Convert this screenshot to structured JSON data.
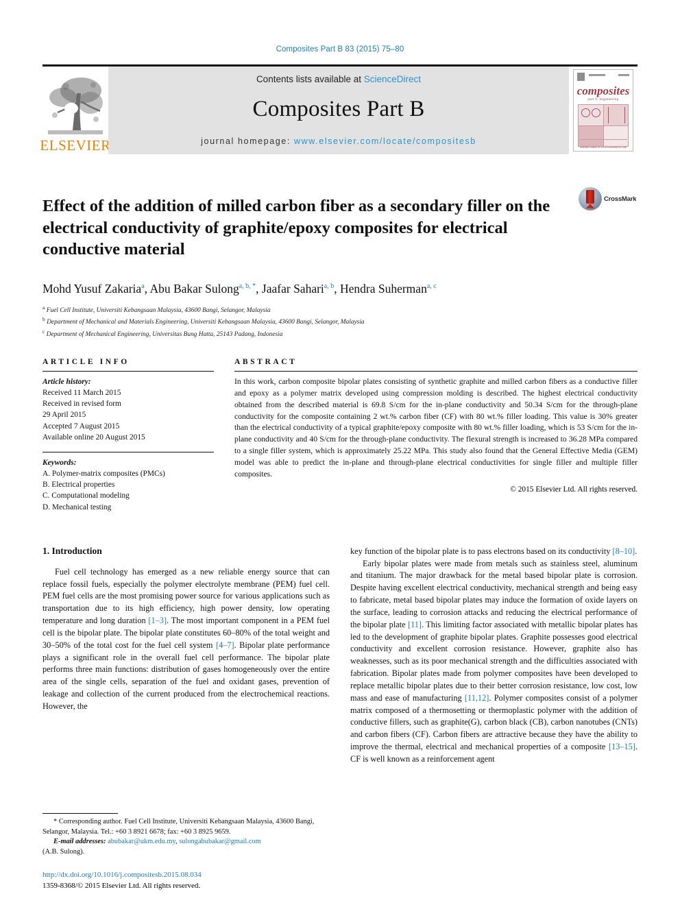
{
  "running_head": "Composites Part B 83 (2015) 75–80",
  "masthead": {
    "publisher": "ELSEVIER",
    "contents_prefix": "Contents lists available at ",
    "contents_link": "ScienceDirect",
    "journal_title": "Composites Part B",
    "homepage_prefix": "journal homepage: ",
    "homepage_url": "www.elsevier.com/locate/compositesb",
    "cover": {
      "title": "composites",
      "subtitle": "part b: engineering",
      "footer": "available online at www.sciencedirect.com"
    }
  },
  "article": {
    "title": "Effect of the addition of milled carbon fiber as a secondary filler on the electrical conductivity of graphite/epoxy composites for electrical conductive material",
    "crossmark_label": "CrossMark",
    "authors": [
      {
        "name": "Mohd Yusuf Zakaria",
        "marks": "a"
      },
      {
        "name": "Abu Bakar Sulong",
        "marks": "a, b, *"
      },
      {
        "name": "Jaafar Sahari",
        "marks": "a, b"
      },
      {
        "name": "Hendra Suherman",
        "marks": "a, c"
      }
    ],
    "affiliations": [
      {
        "mark": "a",
        "text": "Fuel Cell Institute, Universiti Kebangsaan Malaysia, 43600 Bangi, Selangor, Malaysia"
      },
      {
        "mark": "b",
        "text": "Department of Mechanical and Materials Engineering, Universiti Kebangsaan Malaysia, 43600 Bangi, Selangor, Malaysia"
      },
      {
        "mark": "c",
        "text": "Department of Mechanical Engineering, Universitas Bung Hatta, 25143 Padang, Indonesia"
      }
    ]
  },
  "article_info": {
    "heading": "ARTICLE INFO",
    "history_label": "Article history:",
    "history": [
      "Received 11 March 2015",
      "Received in revised form",
      "29 April 2015",
      "Accepted 7 August 2015",
      "Available online 20 August 2015"
    ],
    "keywords_label": "Keywords:",
    "keywords": [
      "A. Polymer-matrix composites (PMCs)",
      "B. Electrical properties",
      "C. Computational modeling",
      "D. Mechanical testing"
    ]
  },
  "abstract": {
    "heading": "ABSTRACT",
    "text": "In this work, carbon composite bipolar plates consisting of synthetic graphite and milled carbon fibers as a conductive filler and epoxy as a polymer matrix developed using compression molding is described. The highest electrical conductivity obtained from the described material is 69.8 S/cm for the in-plane conductivity and 50.34 S/cm for the through-plane conductivity for the composite containing 2 wt.% carbon fiber (CF) with 80 wt.% filler loading. This value is 30% greater than the electrical conductivity of a typical graphite/epoxy composite with 80 wt.% filler loading, which is 53 S/cm for the in-plane conductivity and 40 S/cm for the through-plane conductivity. The flexural strength is increased to 36.28 MPa compared to a single filler system, which is approximately 25.22 MPa. This study also found that the General Effective Media (GEM) model was able to predict the in-plane and through-plane electrical conductivities for single filler and multiple filler composites.",
    "copyright": "© 2015 Elsevier Ltd. All rights reserved."
  },
  "introduction": {
    "section_number": "1.",
    "section_title": "Introduction",
    "left_paragraphs": [
      "Fuel cell technology has emerged as a new reliable energy source that can replace fossil fuels, especially the polymer electrolyte membrane (PEM) fuel cell. PEM fuel cells are the most promising power source for various applications such as transportation due to its high efficiency, high power density, low operating temperature and long duration [1–3]. The most important component in a PEM fuel cell is the bipolar plate. The bipolar plate constitutes 60–80% of the total weight and 30–50% of the total cost for the fuel cell system [4–7]. Bipolar plate performance plays a significant role in the overall fuel cell performance. The bipolar plate performs three main functions: distribution of gases homogeneously over the entire area of the single cells, separation of the fuel and oxidant gases, prevention of leakage and collection of the current produced from the electrochemical reactions. However, the"
    ],
    "right_paragraphs": [
      "key function of the bipolar plate is to pass electrons based on its conductivity [8–10].",
      "Early bipolar plates were made from metals such as stainless steel, aluminum and titanium. The major drawback for the metal based bipolar plate is corrosion. Despite having excellent electrical conductivity, mechanical strength and being easy to fabricate, metal based bipolar plates may induce the formation of oxide layers on the surface, leading to corrosion attacks and reducing the electrical performance of the bipolar plate [11]. This limiting factor associated with metallic bipolar plates has led to the development of graphite bipolar plates. Graphite possesses good electrical conductivity and excellent corrosion resistance. However, graphite also has weaknesses, such as its poor mechanical strength and the difficulties associated with fabrication. Bipolar plates made from polymer composites have been developed to replace metallic bipolar plates due to their better corrosion resistance, low cost, low mass and ease of manufacturing [11,12]. Polymer composites consist of a polymer matrix composed of a thermosetting or thermoplastic polymer with the addition of conductive fillers, such as graphite(G), carbon black (CB), carbon nanotubes (CNTs) and carbon fibers (CF). Carbon fibers are attractive because they have the ability to improve the thermal, electrical and mechanical properties of a composite [13–15]. CF is well known as a reinforcement agent"
    ]
  },
  "footnote": {
    "star": "*",
    "corresponding": "Corresponding author. Fuel Cell Institute, Universiti Kebangsaan Malaysia, 43600 Bangi, Selangor, Malaysia. Tel.: +60 3 8921 6678; fax: +60 3 8925 9659.",
    "email_label": "E-mail addresses:",
    "email_1": "abubakar@ukm.edu.my",
    "email_sep": ",",
    "email_2": "sulongabubakar@gmail.com",
    "email_owner": "(A.B. Sulong)."
  },
  "doi_block": {
    "doi": "http://dx.doi.org/10.1016/j.compositesb.2015.08.034",
    "issn_line": "1359-8368/© 2015 Elsevier Ltd. All rights reserved."
  },
  "colors": {
    "link_blue": "#1a7db5",
    "sciencedirect_blue": "#2a93c9",
    "elsevier_orange": "#f08000",
    "masthead_gray": "#e2e2e2",
    "cover_maroon": "#9c3b47"
  }
}
